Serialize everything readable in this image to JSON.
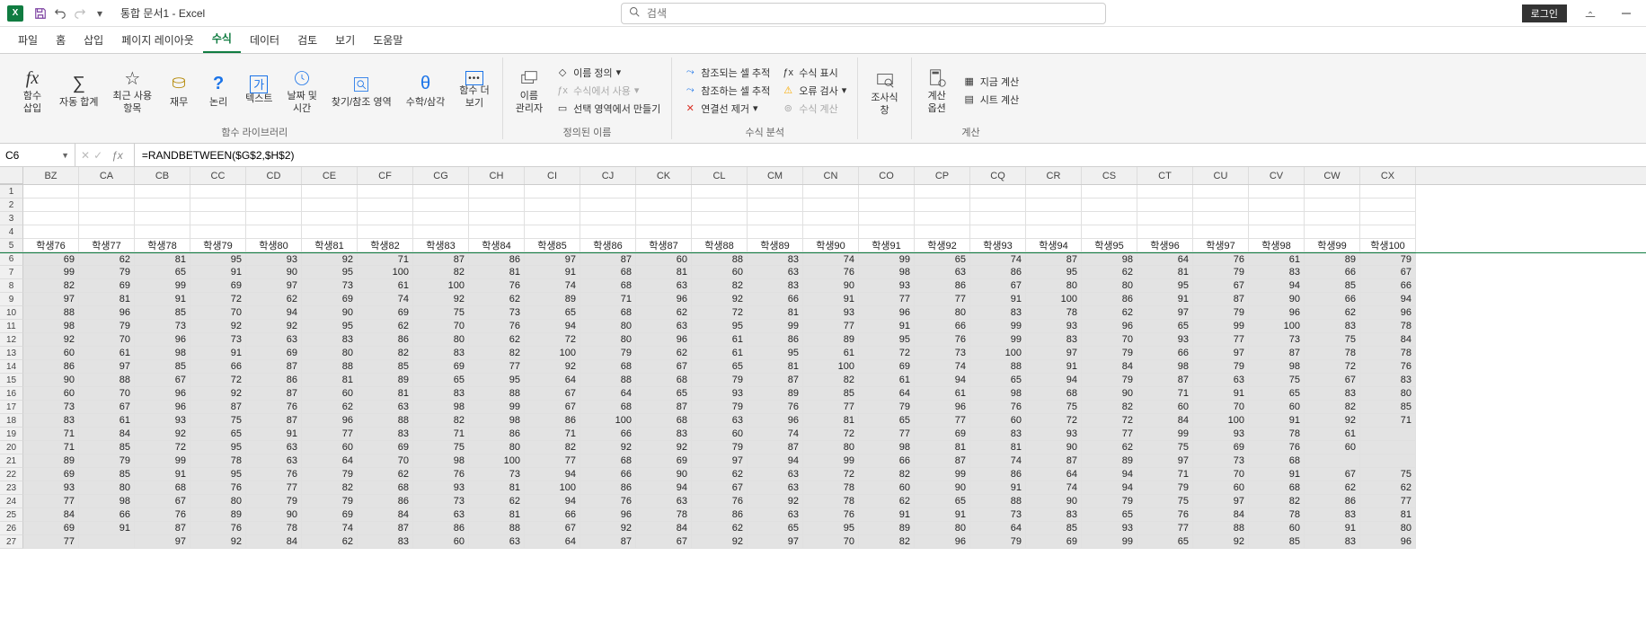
{
  "app": {
    "icon_letter": "X",
    "doc_title": "통합 문서1  -  Excel",
    "search_placeholder": "검색",
    "login_label": "로그인"
  },
  "qat": {
    "save_title": "저장",
    "undo_title": "실행 취소",
    "redo_title": "다시 실행"
  },
  "tabs": {
    "file": "파일",
    "home": "홈",
    "insert": "삽입",
    "layout": "페이지 레이아웃",
    "formulas": "수식",
    "data": "데이터",
    "review": "검토",
    "view": "보기",
    "help": "도움말"
  },
  "ribbon": {
    "insert_fn": "함수\n삽입",
    "sum": "자동 합계",
    "recent": "최근 사용\n항목",
    "financial": "재무",
    "logical": "논리",
    "text": "텍스트",
    "datetime": "날짜 및\n시간",
    "lookup": "찾기/참조 영역",
    "math": "수학/삼각",
    "more": "함수 더\n보기",
    "group_lib": "함수 라이브러리",
    "name_mgr": "이름\n관리자",
    "define_name": "이름 정의",
    "use_in_formula": "수식에서 사용",
    "create_from_sel": "선택 영역에서 만들기",
    "group_names": "정의된 이름",
    "trace_p": "참조되는 셀 추적",
    "trace_d": "참조하는 셀 추적",
    "remove_arrows": "연결선 제거",
    "show_formulas": "수식 표시",
    "error_check": "오류 검사",
    "eval": "수식 계산",
    "group_audit": "수식 분석",
    "watch": "조사식\n창",
    "calc_opt": "계산\n옵션",
    "calc_now": "지금 계산",
    "calc_sheet": "시트 계산",
    "group_calc": "계산"
  },
  "fbar": {
    "name_box": "C6",
    "formula": "=RANDBETWEEN($G$2,$H$2)"
  },
  "columns": [
    "BZ",
    "CA",
    "CB",
    "CC",
    "CD",
    "CE",
    "CF",
    "CG",
    "CH",
    "CI",
    "CJ",
    "CK",
    "CL",
    "CM",
    "CN",
    "CO",
    "CP",
    "CQ",
    "CR",
    "CS",
    "CT",
    "CU",
    "CV",
    "CW",
    "CX"
  ],
  "row_labels": [
    1,
    2,
    3,
    4,
    5,
    6,
    7,
    8,
    9,
    10,
    11,
    12,
    13,
    14,
    15,
    16,
    17,
    18,
    19,
    20,
    21,
    22,
    23,
    24,
    25,
    26,
    27
  ],
  "header_row": [
    "학생76",
    "학생77",
    "학생78",
    "학생79",
    "학생80",
    "학생81",
    "학생82",
    "학생83",
    "학생84",
    "학생85",
    "학생86",
    "학생87",
    "학생88",
    "학생89",
    "학생90",
    "학생91",
    "학생92",
    "학생93",
    "학생94",
    "학생95",
    "학생96",
    "학생97",
    "학생98",
    "학생99",
    "학생100"
  ],
  "data_rows": [
    [
      69,
      62,
      81,
      95,
      93,
      92,
      71,
      87,
      86,
      97,
      87,
      60,
      88,
      83,
      74,
      99,
      65,
      74,
      87,
      98,
      64,
      76,
      61,
      89,
      79
    ],
    [
      99,
      79,
      65,
      91,
      90,
      95,
      100,
      82,
      81,
      91,
      68,
      81,
      60,
      63,
      76,
      98,
      63,
      86,
      95,
      62,
      81,
      79,
      83,
      66,
      67
    ],
    [
      82,
      69,
      99,
      69,
      97,
      73,
      61,
      100,
      76,
      74,
      68,
      63,
      82,
      83,
      90,
      93,
      86,
      67,
      80,
      80,
      95,
      67,
      94,
      85,
      66
    ],
    [
      97,
      81,
      91,
      72,
      62,
      69,
      74,
      92,
      62,
      89,
      71,
      96,
      92,
      66,
      91,
      77,
      77,
      91,
      100,
      86,
      91,
      87,
      90,
      66,
      94
    ],
    [
      88,
      96,
      85,
      70,
      94,
      90,
      69,
      75,
      73,
      65,
      68,
      62,
      72,
      81,
      93,
      96,
      80,
      83,
      78,
      62,
      97,
      79,
      96,
      62,
      96
    ],
    [
      98,
      79,
      73,
      92,
      92,
      95,
      62,
      70,
      76,
      94,
      80,
      63,
      95,
      99,
      77,
      91,
      66,
      99,
      93,
      96,
      65,
      99,
      100,
      83,
      78
    ],
    [
      92,
      70,
      96,
      73,
      63,
      83,
      86,
      80,
      62,
      72,
      80,
      96,
      61,
      86,
      89,
      95,
      76,
      99,
      83,
      70,
      93,
      77,
      73,
      75,
      84
    ],
    [
      60,
      61,
      98,
      91,
      69,
      80,
      82,
      83,
      82,
      100,
      79,
      62,
      61,
      95,
      61,
      72,
      73,
      100,
      97,
      79,
      66,
      97,
      87,
      78,
      78
    ],
    [
      86,
      97,
      85,
      66,
      87,
      88,
      85,
      69,
      77,
      92,
      68,
      67,
      65,
      81,
      100,
      69,
      74,
      88,
      91,
      84,
      98,
      79,
      98,
      72,
      76
    ],
    [
      90,
      88,
      67,
      72,
      86,
      81,
      89,
      65,
      95,
      64,
      88,
      68,
      79,
      87,
      82,
      61,
      94,
      65,
      94,
      79,
      87,
      63,
      75,
      67,
      83
    ],
    [
      60,
      70,
      96,
      92,
      87,
      60,
      81,
      83,
      88,
      67,
      64,
      65,
      93,
      89,
      85,
      64,
      61,
      98,
      68,
      90,
      71,
      91,
      65,
      83,
      80
    ],
    [
      73,
      67,
      96,
      87,
      76,
      62,
      63,
      98,
      99,
      67,
      68,
      87,
      79,
      76,
      77,
      79,
      96,
      76,
      75,
      82,
      60,
      70,
      60,
      82,
      85
    ],
    [
      83,
      61,
      93,
      75,
      87,
      96,
      88,
      82,
      98,
      86,
      100,
      68,
      63,
      96,
      81,
      65,
      77,
      60,
      72,
      72,
      84,
      100,
      91,
      92,
      71
    ],
    [
      71,
      84,
      92,
      65,
      91,
      77,
      83,
      71,
      86,
      71,
      66,
      83,
      60,
      74,
      72,
      77,
      69,
      83,
      93,
      77,
      99,
      93,
      78,
      61
    ],
    [
      71,
      85,
      72,
      95,
      63,
      60,
      69,
      75,
      80,
      82,
      92,
      92,
      79,
      87,
      80,
      98,
      81,
      81,
      90,
      62,
      75,
      69,
      76,
      60
    ],
    [
      89,
      79,
      99,
      78,
      63,
      64,
      70,
      98,
      100,
      77,
      68,
      69,
      97,
      94,
      99,
      66,
      87,
      74,
      87,
      89,
      97,
      73,
      68
    ],
    [
      69,
      85,
      91,
      95,
      76,
      79,
      62,
      76,
      73,
      94,
      66,
      90,
      62,
      63,
      72,
      82,
      99,
      86,
      64,
      94,
      71,
      70,
      91,
      67,
      75
    ],
    [
      93,
      80,
      68,
      76,
      77,
      82,
      68,
      93,
      81,
      100,
      86,
      94,
      67,
      63,
      78,
      60,
      90,
      91,
      74,
      94,
      79,
      60,
      68,
      62,
      62
    ],
    [
      77,
      98,
      67,
      80,
      79,
      79,
      86,
      73,
      62,
      94,
      76,
      63,
      76,
      92,
      78,
      62,
      65,
      88,
      90,
      79,
      75,
      97,
      82,
      86,
      77
    ],
    [
      84,
      66,
      76,
      89,
      90,
      69,
      84,
      63,
      81,
      66,
      96,
      78,
      86,
      63,
      76,
      91,
      91,
      73,
      83,
      65,
      76,
      84,
      78,
      83,
      81
    ],
    [
      69,
      91,
      87,
      76,
      78,
      74,
      87,
      86,
      88,
      67,
      92,
      84,
      62,
      65,
      95,
      89,
      80,
      64,
      85,
      93,
      77,
      88,
      60,
      91,
      80
    ],
    [
      77,
      "",
      97,
      92,
      84,
      62,
      83,
      60,
      63,
      64,
      87,
      67,
      92,
      97,
      70,
      82,
      96,
      79,
      69,
      99,
      65,
      92,
      85,
      83,
      96
    ]
  ],
  "active_cell": {
    "row": 6,
    "col_index": 3
  }
}
